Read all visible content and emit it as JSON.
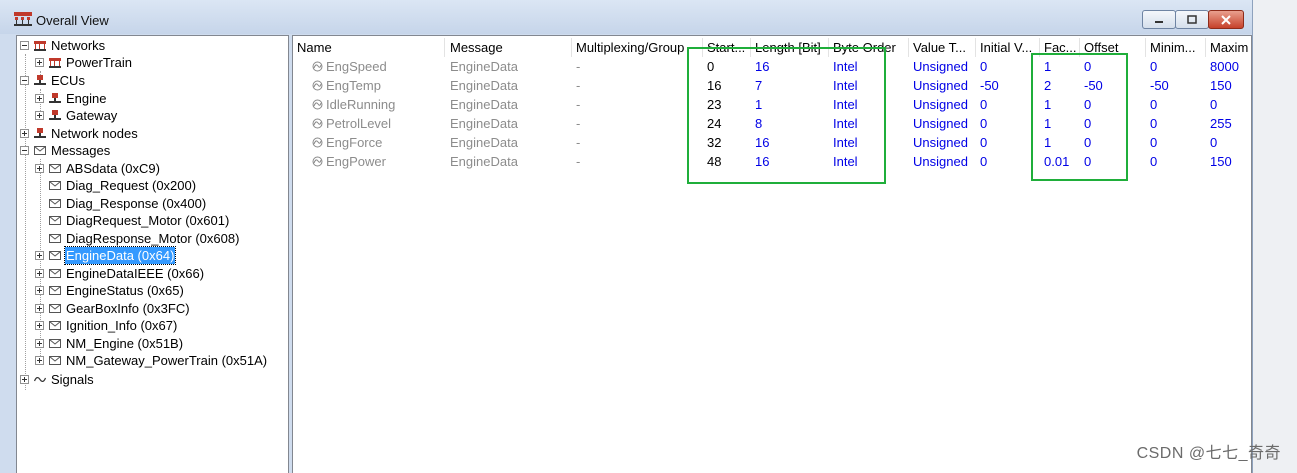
{
  "window": {
    "title": "Overall View",
    "controls": {
      "minimize": "minimize",
      "maximize": "maximize",
      "close": "close"
    }
  },
  "tree": [
    {
      "label": "Networks",
      "icon": "network-icon"
    },
    {
      "label": "PowerTrain",
      "icon": "network-icon"
    },
    {
      "label": "ECUs",
      "icon": "ecu-icon"
    },
    {
      "label": "Engine",
      "icon": "ecu-icon"
    },
    {
      "label": "Gateway",
      "icon": "ecu-icon"
    },
    {
      "label": "Network nodes",
      "icon": "ecu-icon"
    },
    {
      "label": "Messages",
      "icon": "envelope-icon"
    },
    {
      "label": "ABSdata (0xC9)",
      "icon": "envelope-icon"
    },
    {
      "label": "Diag_Request (0x200)",
      "icon": "envelope-icon"
    },
    {
      "label": "Diag_Response (0x400)",
      "icon": "envelope-icon"
    },
    {
      "label": "DiagRequest_Motor (0x601)",
      "icon": "envelope-icon"
    },
    {
      "label": "DiagResponse_Motor (0x608)",
      "icon": "envelope-icon"
    },
    {
      "label": "EngineData (0x64)",
      "icon": "envelope-icon"
    },
    {
      "label": "EngineDataIEEE (0x66)",
      "icon": "envelope-icon"
    },
    {
      "label": "EngineStatus (0x65)",
      "icon": "envelope-icon"
    },
    {
      "label": "GearBoxInfo (0x3FC)",
      "icon": "envelope-icon"
    },
    {
      "label": "Ignition_Info (0x67)",
      "icon": "envelope-icon"
    },
    {
      "label": "NM_Engine (0x51B)",
      "icon": "envelope-icon"
    },
    {
      "label": "NM_Gateway_PowerTrain (0x51A)",
      "icon": "envelope-icon"
    },
    {
      "label": "Signals",
      "icon": "signal-icon"
    }
  ],
  "grid": {
    "columns": [
      "Name",
      "Message",
      "Multiplexing/Group",
      "Start...",
      "Length [Bit]",
      "Byte Order",
      "Value T...",
      "Initial V...",
      "Fac...",
      "Offset",
      "Minim...",
      "Maxim"
    ],
    "rows": [
      [
        "EngSpeed",
        "EngineData",
        "-",
        "0",
        "16",
        "Intel",
        "Unsigned",
        "0",
        "1",
        "0",
        "0",
        "8000"
      ],
      [
        "EngTemp",
        "EngineData",
        "-",
        "16",
        "7",
        "Intel",
        "Unsigned",
        "-50",
        "2",
        "-50",
        "-50",
        "150"
      ],
      [
        "IdleRunning",
        "EngineData",
        "-",
        "23",
        "1",
        "Intel",
        "Unsigned",
        "0",
        "1",
        "0",
        "0",
        "0"
      ],
      [
        "PetrolLevel",
        "EngineData",
        "-",
        "24",
        "8",
        "Intel",
        "Unsigned",
        "0",
        "1",
        "0",
        "0",
        "255"
      ],
      [
        "EngForce",
        "EngineData",
        "-",
        "32",
        "16",
        "Intel",
        "Unsigned",
        "0",
        "1",
        "0",
        "0",
        "0"
      ],
      [
        "EngPower",
        "EngineData",
        "-",
        "48",
        "16",
        "Intel",
        "Unsigned",
        "0",
        "0.01",
        "0",
        "0",
        "150"
      ]
    ]
  },
  "watermark": "CSDN @七七_奇奇",
  "colors": {
    "highlight": "#1fae3a",
    "value_blue": "#0000e6",
    "selection": "#3399ff",
    "dim_text": "#8c8c8c"
  }
}
